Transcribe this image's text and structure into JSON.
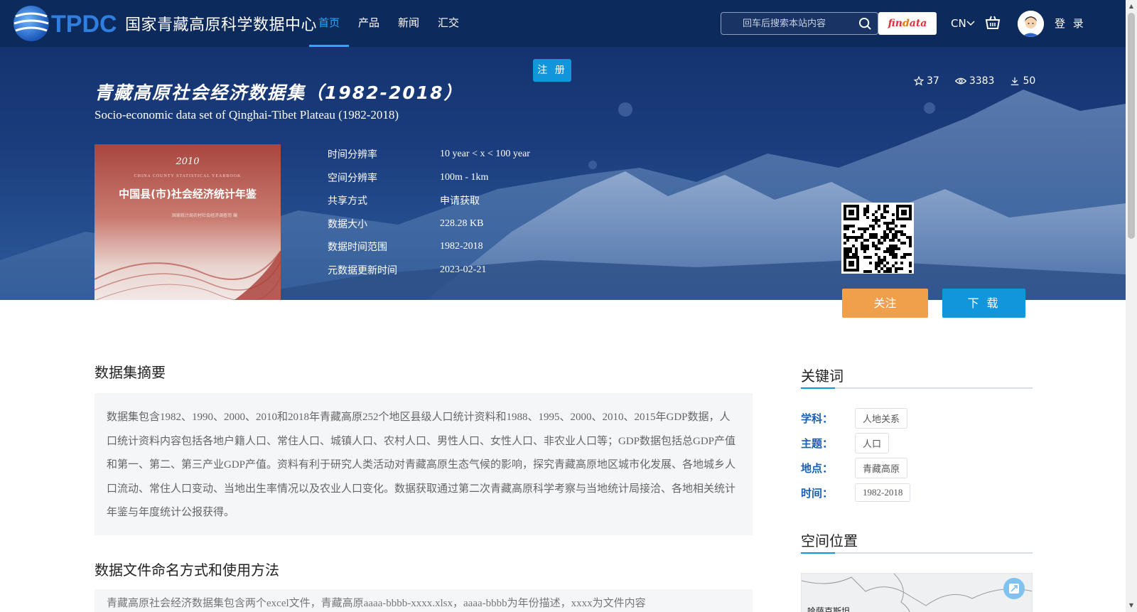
{
  "nav": {
    "logo_abbr": "TPDC",
    "logo_text": "国家青藏高原科学数据中心",
    "links": [
      {
        "label": "首页",
        "active": true
      },
      {
        "label": "产品",
        "active": false
      },
      {
        "label": "新闻",
        "active": false
      },
      {
        "label": "汇交",
        "active": false
      }
    ],
    "search_placeholder": "回车后搜索本站内容",
    "findata_a": "fin",
    "findata_b": "d",
    "findata_c": "ata",
    "lang": "CN",
    "login": "登 录"
  },
  "hero": {
    "register": "注 册",
    "title_cn": "青藏高原社会经济数据集（1982-2018）",
    "title_en": "Socio-economic data set of Qinghai-Tibet Plateau (1982-2018)",
    "stats": {
      "stars": "37",
      "views": "3383",
      "downloads": "50"
    },
    "cover": {
      "year": "2010",
      "en": "CHINA COUNTY STATISTICAL YEARBOOK",
      "title": "中国县(市)社会经济统计年鉴",
      "sub": "国家统计局农村社会经济调查司 编"
    },
    "meta": [
      {
        "label": "时间分辨率",
        "value": "10 year < x < 100 year"
      },
      {
        "label": "空间分辨率",
        "value": "100m - 1km"
      },
      {
        "label": "共享方式",
        "value": "申请获取"
      },
      {
        "label": "数据大小",
        "value": "228.28 KB"
      },
      {
        "label": "数据时间范围",
        "value": "1982-2018"
      },
      {
        "label": "元数据更新时间",
        "value": "2023-02-21"
      }
    ],
    "follow": "关注",
    "download": "下 载"
  },
  "main": {
    "abstract_title": "数据集摘要",
    "abstract_text": "数据集包含1982、1990、2000、2010和2018年青藏高原252个地区县级人口统计资料和1988、1995、2000、2010、2015年GDP数据，人口统计资料内容包括各地户籍人口、常住人口、城镇人口、农村人口、男性人口、女性人口、非农业人口等；GDP数据包括总GDP产值和第一、第二、第三产业GDP产值。资料有利于研究人类活动对青藏高原生态气候的影响，探究青藏高原地区城市化发展、各地城乡人口流动、常住人口变动、当地出生率情况以及农业人口变化。数据获取通过第二次青藏高原科学考察与当地统计局接洽、各地相关统计年鉴与年度统计公报获得。",
    "naming_title": "数据文件命名方式和使用方法",
    "naming_text": "青藏高原社会经济数据集包含两个excel文件，青藏高原aaaa-bbbb-xxxx.xlsx，aaaa-bbbb为年份描述，xxxx为文件内容"
  },
  "sidebar": {
    "keywords_title": "关键词",
    "keywords": [
      {
        "label": "学科：",
        "tag": "人地关系"
      },
      {
        "label": "主题：",
        "tag": "人口"
      },
      {
        "label": "地点：",
        "tag": "青藏高原"
      },
      {
        "label": "时间：",
        "tag": "1982-2018"
      }
    ],
    "location_title": "空间位置",
    "map_label": "哈萨克斯坦"
  },
  "colors": {
    "nav_bg": "#0d2a5c",
    "accent_blue": "#1296db",
    "follow_orange": "#f0a04b",
    "keyword_label": "#1a5fb4"
  }
}
